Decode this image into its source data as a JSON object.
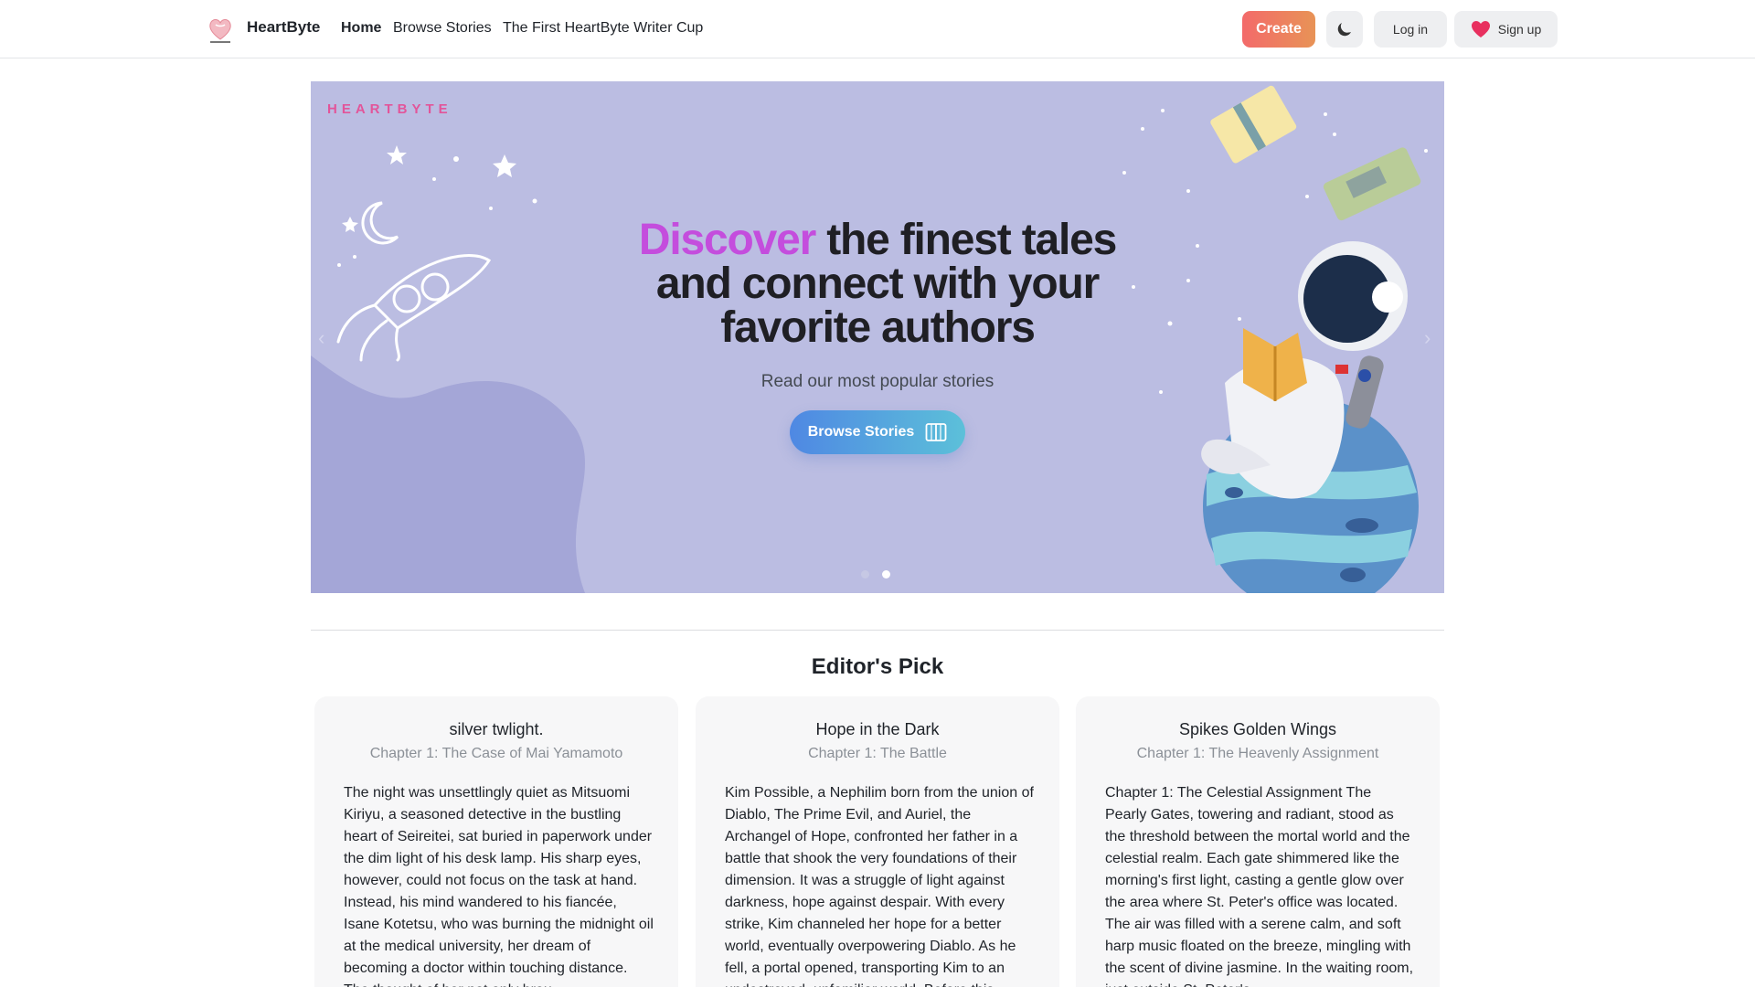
{
  "brand": {
    "name": "HeartByte",
    "logo_text": "HeartByte"
  },
  "nav": {
    "links": [
      {
        "label": "Home",
        "active": true
      },
      {
        "label": "Browse Stories",
        "active": false
      },
      {
        "label": "The First HeartByte Writer Cup",
        "active": false
      }
    ],
    "create_label": "Create",
    "theme_icon": "moon-icon",
    "login_label": "Log in",
    "signup_label": "Sign up",
    "signup_icon": "heart-icon"
  },
  "hero": {
    "wordmark": "HEARTBYTE",
    "title_accent": "Discover",
    "title_rest": " the finest tales and connect with your favorite authors",
    "subtitle": "Read our most popular stories",
    "button_label": "Browse Stories",
    "button_icon": "book-open-icon",
    "slide_count": 2,
    "active_slide": 2
  },
  "editors_pick": {
    "title": "Editor's Pick",
    "cards": [
      {
        "title": "silver twlight.",
        "chapter": "Chapter 1: The Case of Mai Yamamoto",
        "body": "The night was unsettlingly quiet as Mitsuomi Kiriyu, a seasoned detective in the bustling heart of Seireitei, sat buried in paperwork under the dim light of his desk lamp. His sharp eyes, however, could not focus on the task at hand. Instead, his mind wandered to his fiancée, Isane Kotetsu, who was burning the midnight oil at the medical university, her dream of becoming a doctor within touching distance. The thought of her not only brou..."
      },
      {
        "title": "Hope in the Dark",
        "chapter": "Chapter 1: The Battle",
        "body": "Kim Possible, a Nephilim born from the union of Diablo, The Prime Evil, and Auriel, the Archangel of Hope, confronted her father in a battle that shook the very foundations of their dimension. It was a struggle of light against darkness, hope against despair. With every strike, Kim channeled her hope for a better world, eventually overpowering Diablo. As he fell, a portal opened, transporting Kim to an undestroyed, unfamiliar world. Before this..."
      },
      {
        "title": "Spikes Golden Wings",
        "chapter": "Chapter 1: The Heavenly Assignment",
        "body": "Chapter 1: The Celestial Assignment The Pearly Gates, towering and radiant, stood as the threshold between the mortal world and the celestial realm. Each gate shimmered like the morning's first light, casting a gentle glow over the area where St. Peter's office was located. The air was filled with a serene calm, and soft harp music floated on the breeze, mingling with the scent of divine jasmine. In the waiting room, just outside St. Peter's..."
      }
    ]
  },
  "colors": {
    "hero_bg": "#bbbde2",
    "accent_purple": "#c44ddd",
    "wordmark_pink": "#e2559a",
    "create_gradient_start": "#f36a6a",
    "create_gradient_end": "#e89356",
    "browse_gradient_start": "#4f88e3",
    "browse_gradient_end": "#5cc0d9"
  }
}
